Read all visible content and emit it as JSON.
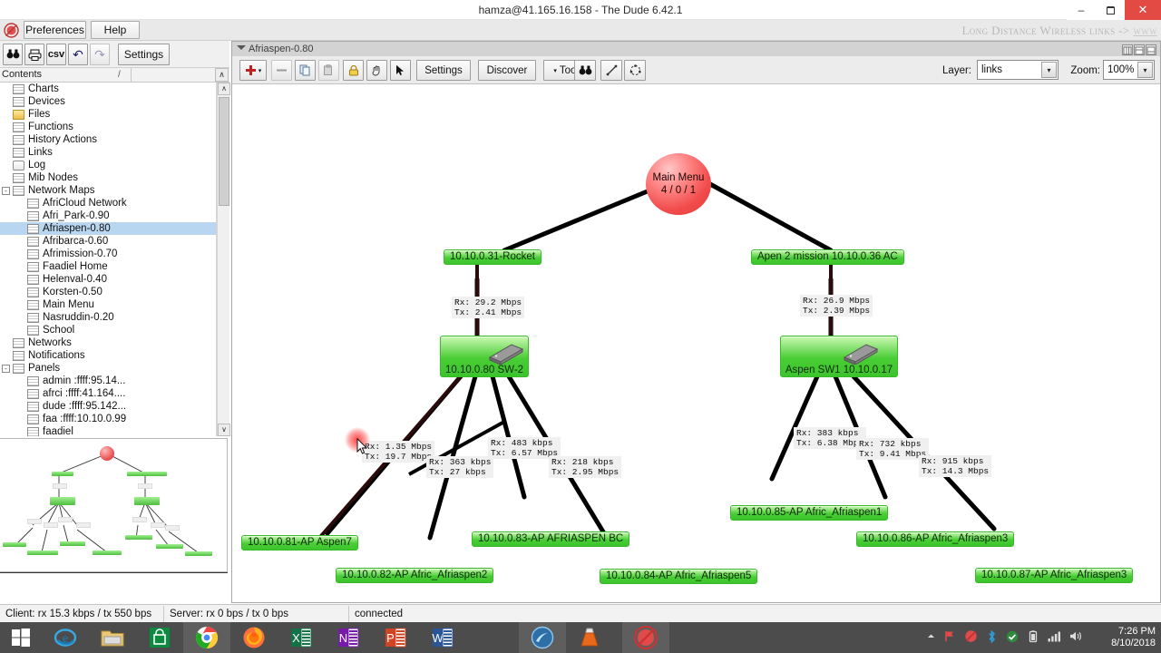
{
  "window": {
    "title": "hamza@41.165.16.158 - The Dude 6.42.1",
    "minimize": "–",
    "maximize": "❐",
    "close": "✕"
  },
  "app_menu": {
    "logo_icon": "dude-logo-icon",
    "buttons": [
      {
        "label": "Preferences",
        "name": "preferences-button"
      },
      {
        "label": "Help",
        "name": "help-button"
      }
    ],
    "brand": "Long Distance Wireless links ->",
    "brand_link": "www"
  },
  "left_toolbar": {
    "buttons": [
      {
        "label": "⌘",
        "icon": "binoculars-icon",
        "name": "find-button"
      },
      {
        "label": "⎙",
        "icon": "printer-icon",
        "name": "print-button"
      },
      {
        "label": "csv",
        "icon": "csv-icon",
        "name": "csv-export-button"
      },
      {
        "label": "↶",
        "icon": "undo-icon",
        "name": "undo-button"
      },
      {
        "label": "↷",
        "icon": "redo-icon",
        "name": "redo-button"
      },
      {
        "label": "Settings",
        "icon": "settings-icon",
        "name": "left-settings-button"
      }
    ]
  },
  "contents": {
    "header": "Contents",
    "sort_indicator": "/",
    "scroll_up": "∧",
    "scroll_down": "∨",
    "tree": [
      {
        "label": "Charts",
        "indent": 0,
        "icon": "grid-icon",
        "expander": ""
      },
      {
        "label": "Devices",
        "indent": 0,
        "icon": "grid-icon",
        "expander": ""
      },
      {
        "label": "Files",
        "indent": 0,
        "icon": "folder-icon",
        "expander": ""
      },
      {
        "label": "Functions",
        "indent": 0,
        "icon": "grid-icon",
        "expander": ""
      },
      {
        "label": "History Actions",
        "indent": 0,
        "icon": "grid-icon",
        "expander": ""
      },
      {
        "label": "Links",
        "indent": 0,
        "icon": "grid-icon",
        "expander": ""
      },
      {
        "label": "Log",
        "indent": 0,
        "icon": "log-icon",
        "expander": ""
      },
      {
        "label": "Mib Nodes",
        "indent": 0,
        "icon": "grid-icon",
        "expander": ""
      },
      {
        "label": "Network Maps",
        "indent": 0,
        "icon": "grid-icon",
        "expander": "-"
      },
      {
        "label": "AfriCloud Network",
        "indent": 1,
        "icon": "grid-icon",
        "expander": ""
      },
      {
        "label": "Afri_Park-0.90",
        "indent": 1,
        "icon": "grid-icon",
        "expander": ""
      },
      {
        "label": "Afriaspen-0.80",
        "indent": 1,
        "icon": "grid-icon",
        "expander": "",
        "selected": true
      },
      {
        "label": "Afribarca-0.60",
        "indent": 1,
        "icon": "grid-icon",
        "expander": ""
      },
      {
        "label": "Afrimission-0.70",
        "indent": 1,
        "icon": "grid-icon",
        "expander": ""
      },
      {
        "label": "Faadiel Home",
        "indent": 1,
        "icon": "grid-icon",
        "expander": ""
      },
      {
        "label": "Helenval-0.40",
        "indent": 1,
        "icon": "grid-icon",
        "expander": ""
      },
      {
        "label": "Korsten-0.50",
        "indent": 1,
        "icon": "grid-icon",
        "expander": ""
      },
      {
        "label": "Main Menu",
        "indent": 1,
        "icon": "grid-icon",
        "expander": ""
      },
      {
        "label": "Nasruddin-0.20",
        "indent": 1,
        "icon": "grid-icon",
        "expander": ""
      },
      {
        "label": "School",
        "indent": 1,
        "icon": "grid-icon",
        "expander": ""
      },
      {
        "label": "Networks",
        "indent": 0,
        "icon": "grid-icon",
        "expander": ""
      },
      {
        "label": "Notifications",
        "indent": 0,
        "icon": "grid-icon",
        "expander": ""
      },
      {
        "label": "Panels",
        "indent": 0,
        "icon": "grid-icon",
        "expander": "-"
      },
      {
        "label": "admin :ffff:95.14...",
        "indent": 1,
        "icon": "grid-icon",
        "expander": ""
      },
      {
        "label": "afrci :ffff:41.164....",
        "indent": 1,
        "icon": "grid-icon",
        "expander": ""
      },
      {
        "label": "dude :ffff:95.142...",
        "indent": 1,
        "icon": "grid-icon",
        "expander": ""
      },
      {
        "label": "faa :ffff:10.10.0.99",
        "indent": 1,
        "icon": "grid-icon",
        "expander": ""
      },
      {
        "label": "faadiel",
        "indent": 1,
        "icon": "grid-icon",
        "expander": ""
      }
    ]
  },
  "map_window": {
    "title": "Afriaspen-0.80",
    "caret_icon": "chevron-down-icon",
    "win_buttons": [
      "minimize",
      "maximize",
      "close"
    ],
    "toolbar": {
      "add": {
        "label": "✚",
        "name": "add-button",
        "icon": "plus-icon"
      },
      "add_caret": "▾",
      "remove": {
        "label": "—",
        "name": "remove-button",
        "icon": "minus-icon"
      },
      "copy": {
        "name": "copy-button",
        "icon": "copy-icon"
      },
      "paste": {
        "name": "paste-button",
        "icon": "paste-icon"
      },
      "lock": {
        "name": "lock-button",
        "icon": "lock-icon"
      },
      "pan": {
        "name": "pan-button",
        "icon": "hand-icon"
      },
      "select": {
        "name": "select-button",
        "icon": "arrow-cursor-icon"
      },
      "settings": {
        "label": "Settings",
        "name": "map-settings-button"
      },
      "discover": {
        "label": "Discover",
        "name": "discover-button"
      },
      "tools": {
        "label": "Tools",
        "caret": "▾",
        "name": "tools-button"
      },
      "find": {
        "name": "map-find-button",
        "icon": "binoculars-icon"
      },
      "link": {
        "name": "link-tool-button",
        "icon": "link-icon"
      },
      "arrange": {
        "name": "arrange-button",
        "icon": "arrange-icon"
      }
    },
    "layer": {
      "label": "Layer:",
      "value": "links",
      "arrow": "▾"
    },
    "zoom": {
      "label": "Zoom:",
      "value": "100%",
      "arrow": "▾"
    }
  },
  "map": {
    "root": {
      "name": "Main Menu",
      "counts": "4 / 0 / 1"
    },
    "nodes": [
      {
        "id": "rocket",
        "label": "10.10.0.31-Rocket"
      },
      {
        "id": "apen2",
        "label": "Apen 2 mission 10.10.0.36 AC"
      },
      {
        "id": "sw2",
        "label": "10.10.0.80 SW-2",
        "type": "switch"
      },
      {
        "id": "aspensw1",
        "label": "Aspen SW1 10.10.0.17",
        "type": "switch"
      },
      {
        "id": "ap81",
        "label": "10.10.0.81-AP Aspen7"
      },
      {
        "id": "ap82",
        "label": "10.10.0.82-AP Afric_Afriaspen2"
      },
      {
        "id": "ap83",
        "label": "10.10.0.83-AP AFRIASPEN BC"
      },
      {
        "id": "ap84",
        "label": "10.10.0.84-AP Afric_Afriaspen5"
      },
      {
        "id": "ap85",
        "label": "10.10.0.85-AP Afric_Afriaspen1"
      },
      {
        "id": "ap86",
        "label": "10.10.0.86-AP Afric_Afriaspen3"
      },
      {
        "id": "ap87",
        "label": "10.10.0.87-AP Afric_Afriaspen3"
      }
    ],
    "link_labels": [
      {
        "id": "l1",
        "rx": "Rx:  29.2 Mbps",
        "tx": "Tx:  2.41 Mbps"
      },
      {
        "id": "l2",
        "rx": "Rx:  26.9 Mbps",
        "tx": "Tx:  2.39 Mbps"
      },
      {
        "id": "l3",
        "rx": "Rx:  1.35 Mbps",
        "tx": "Tx:  19.7 Mbps"
      },
      {
        "id": "l4",
        "rx": "Rx:  363 kbps",
        "tx": "Tx:  27 kbps"
      },
      {
        "id": "l5",
        "rx": "Rx:  483 kbps",
        "tx": "Tx:  6.57 Mbps"
      },
      {
        "id": "l6",
        "rx": "Rx:  218 kbps",
        "tx": "Tx:  2.95 Mbps"
      },
      {
        "id": "l7",
        "rx": "Rx:  383 kbps",
        "tx": "Tx:  6.38 Mbps"
      },
      {
        "id": "l8",
        "rx": "Rx:  732 kbps",
        "tx": "Tx:  9.41 Mbps"
      },
      {
        "id": "l9",
        "rx": "Rx:  915 kbps",
        "tx": "Tx:  14.3 Mbps"
      }
    ]
  },
  "statusbar": {
    "client": "Client: rx 15.3 kbps / tx 550 bps",
    "server": "Server: rx 0 bps / tx 0 bps",
    "connection": "connected"
  },
  "taskbar": {
    "start_icon": "windows-start-icon",
    "items": [
      {
        "name": "internet-explorer-icon"
      },
      {
        "name": "file-explorer-icon"
      },
      {
        "name": "microsoft-store-icon"
      },
      {
        "name": "chrome-icon",
        "active": true
      },
      {
        "name": "firefox-icon"
      },
      {
        "name": "excel-icon"
      },
      {
        "name": "onenote-icon"
      },
      {
        "name": "powerpoint-icon"
      },
      {
        "name": "word-icon"
      },
      {
        "name": "winbox-icon"
      },
      {
        "name": "vlc-icon"
      },
      {
        "name": "dude-icon",
        "active": true
      }
    ],
    "tray": [
      {
        "name": "show-hidden-icons-icon"
      },
      {
        "name": "flag-icon"
      },
      {
        "name": "dude-tray-icon"
      },
      {
        "name": "bluetooth-icon"
      },
      {
        "name": "safely-remove-icon"
      },
      {
        "name": "battery-icon"
      },
      {
        "name": "network-signal-icon"
      },
      {
        "name": "volume-icon"
      }
    ],
    "time": "7:26 PM",
    "date": "8/10/2018"
  },
  "colors": {
    "node_green": "#49cd35",
    "root_red": "#f24b4b",
    "selection_blue": "#b8d6f0",
    "close_red": "#e24a43",
    "taskbar": "#4c4c4c"
  }
}
